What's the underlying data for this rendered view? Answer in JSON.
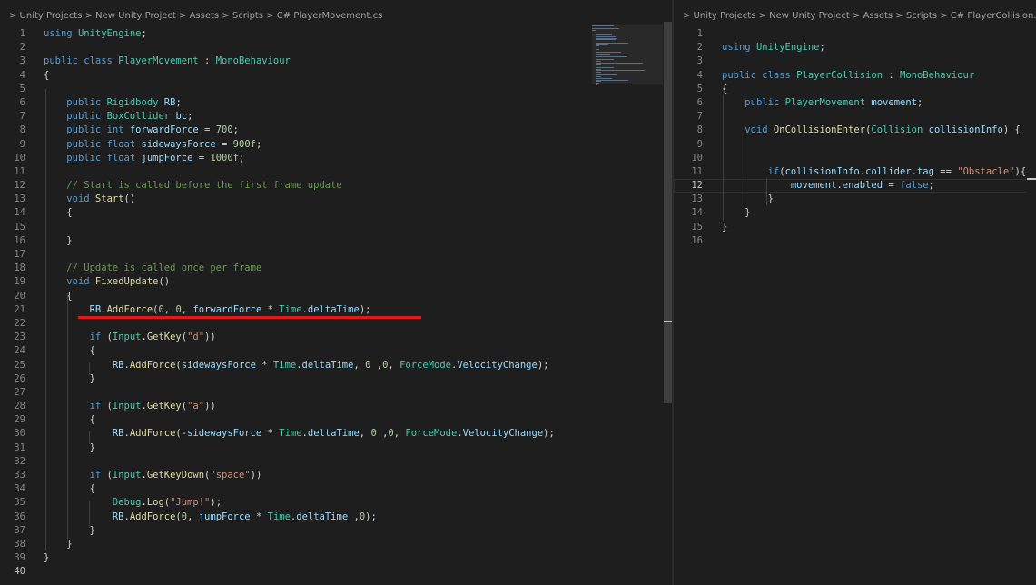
{
  "left": {
    "breadcrumb": "> Unity Projects > New Unity Project > Assets > Scripts > C# PlayerMovement.cs",
    "lines": [
      {
        "n": "1",
        "code": "using UnityEngine;"
      },
      {
        "n": "2",
        "code": ""
      },
      {
        "n": "3",
        "code": "public class PlayerMovement : MonoBehaviour"
      },
      {
        "n": "4",
        "code": "{"
      },
      {
        "n": "5",
        "code": ""
      },
      {
        "n": "6",
        "code": "    public Rigidbody RB;"
      },
      {
        "n": "7",
        "code": "    public BoxCollider bc;"
      },
      {
        "n": "8",
        "code": "    public int forwardForce = 700;"
      },
      {
        "n": "9",
        "code": "    public float sidewaysForce = 900f;"
      },
      {
        "n": "10",
        "code": "    public float jumpForce = 1000f;"
      },
      {
        "n": "11",
        "code": ""
      },
      {
        "n": "12",
        "code": "    // Start is called before the first frame update"
      },
      {
        "n": "13",
        "code": "    void Start()"
      },
      {
        "n": "14",
        "code": "    {"
      },
      {
        "n": "15",
        "code": ""
      },
      {
        "n": "16",
        "code": "    }"
      },
      {
        "n": "17",
        "code": ""
      },
      {
        "n": "18",
        "code": "    // Update is called once per frame"
      },
      {
        "n": "19",
        "code": "    void FixedUpdate()"
      },
      {
        "n": "20",
        "code": "    {"
      },
      {
        "n": "21",
        "code": "        RB.AddForce(0, 0, forwardForce * Time.deltaTime);"
      },
      {
        "n": "22",
        "code": ""
      },
      {
        "n": "23",
        "code": "        if (Input.GetKey(\"d\"))"
      },
      {
        "n": "24",
        "code": "        {"
      },
      {
        "n": "25",
        "code": "            RB.AddForce(sidewaysForce * Time.deltaTime, 0 ,0, ForceMode.VelocityChange);"
      },
      {
        "n": "26",
        "code": "        }"
      },
      {
        "n": "27",
        "code": ""
      },
      {
        "n": "28",
        "code": "        if (Input.GetKey(\"a\"))"
      },
      {
        "n": "29",
        "code": "        {"
      },
      {
        "n": "30",
        "code": "            RB.AddForce(-sidewaysForce * Time.deltaTime, 0 ,0, ForceMode.VelocityChange);"
      },
      {
        "n": "31",
        "code": "        }"
      },
      {
        "n": "32",
        "code": ""
      },
      {
        "n": "33",
        "code": "        if (Input.GetKeyDown(\"space\"))"
      },
      {
        "n": "34",
        "code": "        {"
      },
      {
        "n": "35",
        "code": "            Debug.Log(\"Jump!\");"
      },
      {
        "n": "36",
        "code": "            RB.AddForce(0, jumpForce * Time.deltaTime ,0);"
      },
      {
        "n": "37",
        "code": "        }"
      },
      {
        "n": "38",
        "code": "    }"
      },
      {
        "n": "39",
        "code": "}"
      },
      {
        "n": "40",
        "code": ""
      }
    ],
    "active_line": "40"
  },
  "right": {
    "breadcrumb": "> Unity Projects > New Unity Project > Assets > Scripts > C# PlayerCollision.cs",
    "lines": [
      {
        "n": "1",
        "code": ""
      },
      {
        "n": "2",
        "code": "using UnityEngine;"
      },
      {
        "n": "3",
        "code": ""
      },
      {
        "n": "4",
        "code": "public class PlayerCollision : MonoBehaviour"
      },
      {
        "n": "5",
        "code": "{"
      },
      {
        "n": "6",
        "code": "    public PlayerMovement movement;"
      },
      {
        "n": "7",
        "code": ""
      },
      {
        "n": "8",
        "code": "    void OnCollisionEnter(Collision collisionInfo) {"
      },
      {
        "n": "9",
        "code": ""
      },
      {
        "n": "10",
        "code": ""
      },
      {
        "n": "11",
        "code": "        if(collisionInfo.collider.tag == \"Obstacle\"){"
      },
      {
        "n": "12",
        "code": "            movement.enabled = false;"
      },
      {
        "n": "13",
        "code": "        }"
      },
      {
        "n": "14",
        "code": "    }"
      },
      {
        "n": "15",
        "code": "}"
      },
      {
        "n": "16",
        "code": ""
      }
    ],
    "active_line": "12"
  },
  "colors": {
    "background": "#1e1e1e",
    "keyword": "#569cd6",
    "type": "#4ec9b0",
    "function": "#dcdcaa",
    "variable": "#9cdcfe",
    "number": "#b5cea8",
    "string": "#ce9178",
    "comment": "#6a9955",
    "annotation_underline": "#e0191b"
  }
}
